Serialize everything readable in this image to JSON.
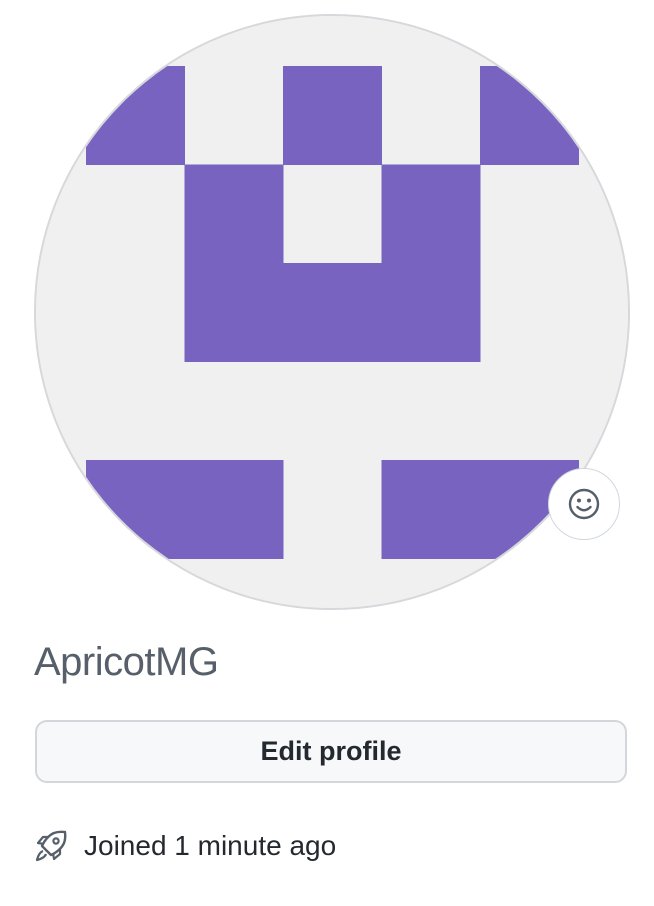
{
  "profile": {
    "username": "ApricotMG",
    "edit_button_label": "Edit profile",
    "joined_text": "Joined 1 minute ago"
  },
  "avatar": {
    "kind": "identicon",
    "fg_color": "#7864c0",
    "bg_color": "#f0f0f0",
    "grid": [
      [
        1,
        0,
        1,
        0,
        1
      ],
      [
        0,
        1,
        0,
        1,
        0
      ],
      [
        0,
        1,
        1,
        1,
        0
      ],
      [
        0,
        0,
        0,
        0,
        0
      ],
      [
        1,
        1,
        0,
        1,
        1
      ]
    ]
  },
  "icons": {
    "status": "smiley-icon",
    "joined": "rocket-icon"
  },
  "colors": {
    "username": "#57606a",
    "text": "#24292f",
    "button_bg": "#f6f8fa",
    "button_border": "#d3d6da",
    "avatar_border": "#d7d8dc"
  }
}
